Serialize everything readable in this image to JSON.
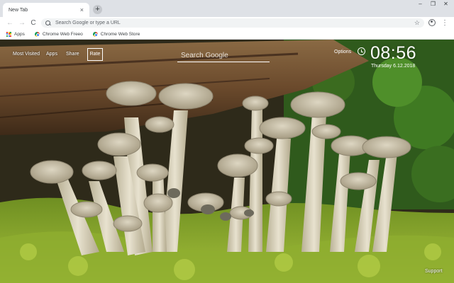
{
  "tab": {
    "title": "New Tab",
    "close": "×"
  },
  "new_tab_button": "+",
  "window_controls": {
    "minimize": "–",
    "maximize": "❐",
    "close": "✕"
  },
  "toolbar": {
    "back": "←",
    "forward": "→",
    "reload": "C",
    "omnibox_placeholder": "Search Google or type a URL",
    "star": "☆",
    "menu": "⋮"
  },
  "bookmarks": [
    {
      "label": "Apps",
      "icon": "apps-grid-icon"
    },
    {
      "label": "Chrome Web Freeo",
      "icon": "chrome-web-store-icon"
    },
    {
      "label": "Chrome Web Store",
      "icon": "chrome-web-store-icon"
    }
  ],
  "ntp": {
    "links": {
      "most_visited": "Most Visited",
      "apps": "Apps",
      "share": "Share",
      "rate": "Rate"
    },
    "search_placeholder": "Search Google",
    "options": "Options",
    "clock": {
      "time": "08:56",
      "date": "Thursday   6.12.2018"
    },
    "support": "Support"
  },
  "colors": {
    "tabstrip": "#dee1e6",
    "toolbar": "#ffffff",
    "omnibox": "#f1f3f4",
    "moss": "#7a9a2a",
    "wood": "#6b4a2c",
    "mushroom": "#cfc7b0"
  }
}
